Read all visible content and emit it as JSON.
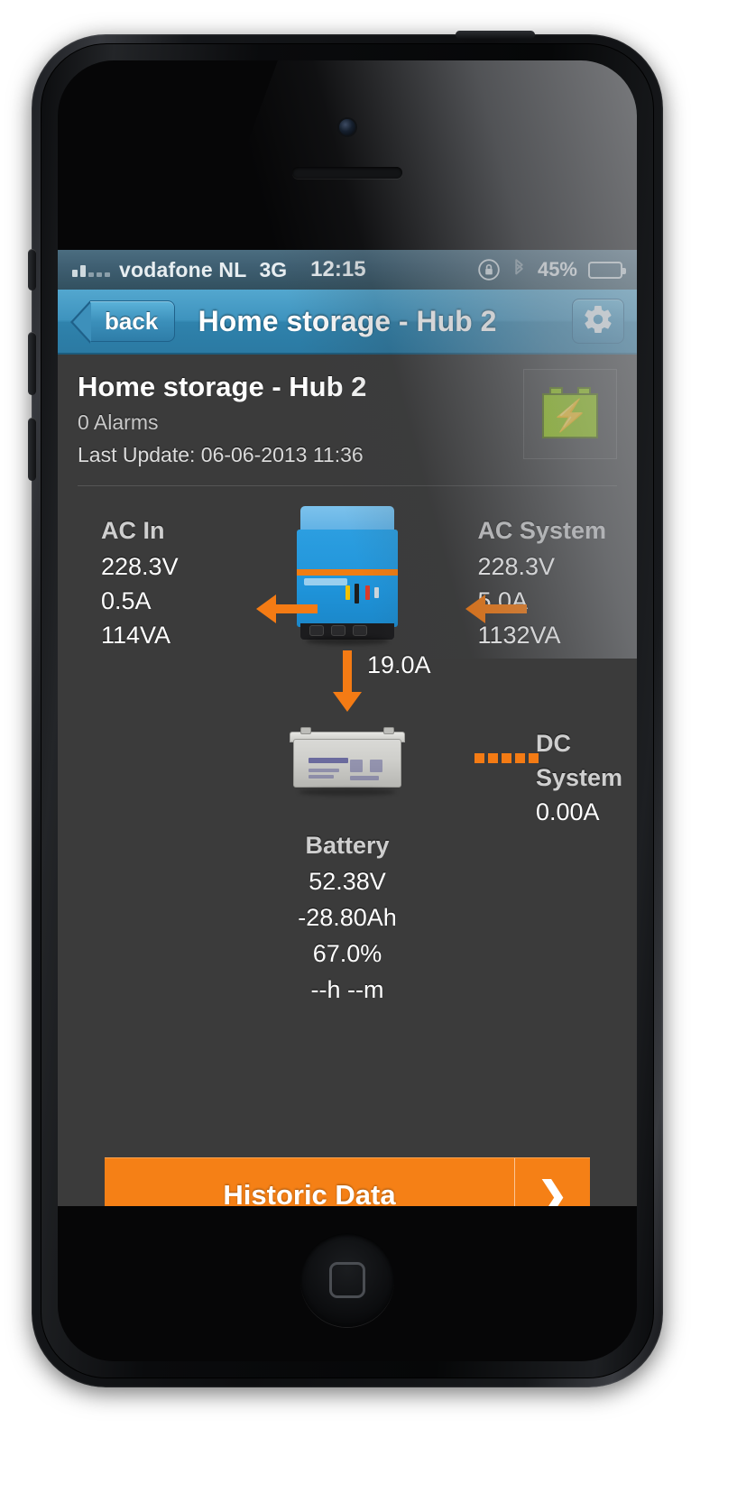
{
  "status_bar": {
    "carrier": "vodafone NL",
    "network": "3G",
    "clock": "12:15",
    "battery_percent": "45%",
    "rotation_lock_icon": "rotation-lock-icon",
    "bluetooth_icon": "bluetooth-icon",
    "battery_icon": "battery-icon",
    "signal_icon": "signal-bars-icon"
  },
  "nav_bar": {
    "back_label": "back",
    "title": "Home storage - Hub 2",
    "settings_icon": "gear-icon"
  },
  "header": {
    "title": "Home storage - Hub 2",
    "alarms": "0 Alarms",
    "last_update": "Last Update: 06-06-2013 11:36",
    "thumb_icon": "battery-charging-icon"
  },
  "diagram": {
    "ac_in": {
      "label": "AC In",
      "voltage": "228.3V",
      "current": "0.5A",
      "power": "114VA"
    },
    "ac_system": {
      "label": "AC System",
      "voltage": "228.3V",
      "current": "5.0A",
      "power": "1132VA"
    },
    "inverter_icon": "multiplus-inverter-icon",
    "dc_flow_current": "19.0A",
    "dc_system": {
      "label": "DC System",
      "current": "0.00A"
    },
    "battery_icon": "lead-acid-battery-icon",
    "battery": {
      "label": "Battery",
      "voltage": "52.38V",
      "charge": "-28.80Ah",
      "soc": "67.0%",
      "time_remaining": "--h --m"
    }
  },
  "historic_button": {
    "label": "Historic Data",
    "chevron_icon": "chevron-right-icon"
  },
  "colors": {
    "accent_orange": "#f58016",
    "nav_blue": "#3e93be",
    "status_blue": "#3f5f72",
    "screen_bg": "#3b3b3b",
    "battery_green": "#8ec409"
  }
}
